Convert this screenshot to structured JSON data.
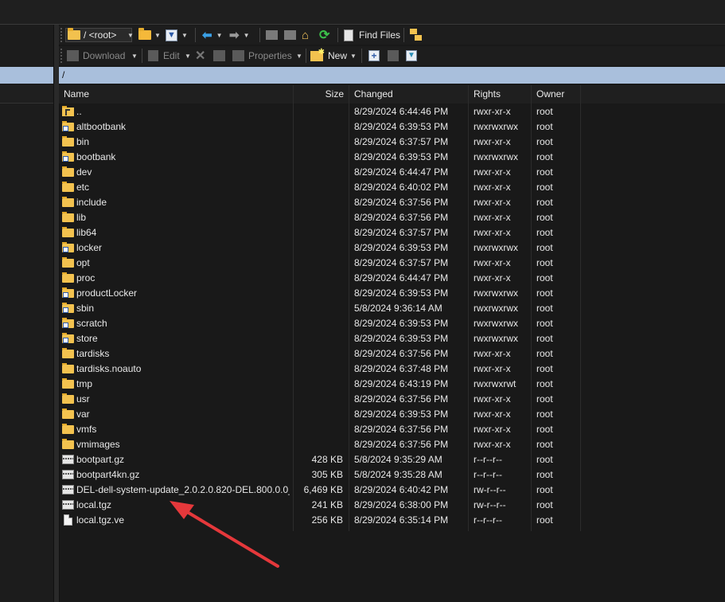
{
  "toolbar1": {
    "path_dropdown_label": "/ <root>",
    "find_files_label": "Find Files"
  },
  "toolbar2": {
    "download_label": "Download",
    "edit_label": "Edit",
    "properties_label": "Properties",
    "new_label": "New"
  },
  "path_bar": {
    "path": "/"
  },
  "columns": {
    "name": "Name",
    "size": "Size",
    "changed": "Changed",
    "rights": "Rights",
    "owner": "Owner"
  },
  "files": [
    {
      "name": "..",
      "icon": "parent-folder-icon",
      "size": "",
      "changed": "8/29/2024 6:44:46 PM",
      "rights": "rwxr-xr-x",
      "owner": "root"
    },
    {
      "name": "altbootbank",
      "icon": "folder-link-icon",
      "size": "",
      "changed": "8/29/2024 6:39:53 PM",
      "rights": "rwxrwxrwx",
      "owner": "root"
    },
    {
      "name": "bin",
      "icon": "folder-icon",
      "size": "",
      "changed": "8/29/2024 6:37:57 PM",
      "rights": "rwxr-xr-x",
      "owner": "root"
    },
    {
      "name": "bootbank",
      "icon": "folder-link-icon",
      "size": "",
      "changed": "8/29/2024 6:39:53 PM",
      "rights": "rwxrwxrwx",
      "owner": "root"
    },
    {
      "name": "dev",
      "icon": "folder-icon",
      "size": "",
      "changed": "8/29/2024 6:44:47 PM",
      "rights": "rwxr-xr-x",
      "owner": "root"
    },
    {
      "name": "etc",
      "icon": "folder-icon",
      "size": "",
      "changed": "8/29/2024 6:40:02 PM",
      "rights": "rwxr-xr-x",
      "owner": "root"
    },
    {
      "name": "include",
      "icon": "folder-icon",
      "size": "",
      "changed": "8/29/2024 6:37:56 PM",
      "rights": "rwxr-xr-x",
      "owner": "root"
    },
    {
      "name": "lib",
      "icon": "folder-icon",
      "size": "",
      "changed": "8/29/2024 6:37:56 PM",
      "rights": "rwxr-xr-x",
      "owner": "root"
    },
    {
      "name": "lib64",
      "icon": "folder-icon",
      "size": "",
      "changed": "8/29/2024 6:37:57 PM",
      "rights": "rwxr-xr-x",
      "owner": "root"
    },
    {
      "name": "locker",
      "icon": "folder-link-icon",
      "size": "",
      "changed": "8/29/2024 6:39:53 PM",
      "rights": "rwxrwxrwx",
      "owner": "root"
    },
    {
      "name": "opt",
      "icon": "folder-icon",
      "size": "",
      "changed": "8/29/2024 6:37:57 PM",
      "rights": "rwxr-xr-x",
      "owner": "root"
    },
    {
      "name": "proc",
      "icon": "folder-icon",
      "size": "",
      "changed": "8/29/2024 6:44:47 PM",
      "rights": "rwxr-xr-x",
      "owner": "root"
    },
    {
      "name": "productLocker",
      "icon": "folder-link-icon",
      "size": "",
      "changed": "8/29/2024 6:39:53 PM",
      "rights": "rwxrwxrwx",
      "owner": "root"
    },
    {
      "name": "sbin",
      "icon": "folder-link-icon",
      "size": "",
      "changed": "5/8/2024 9:36:14 AM",
      "rights": "rwxrwxrwx",
      "owner": "root"
    },
    {
      "name": "scratch",
      "icon": "folder-link-icon",
      "size": "",
      "changed": "8/29/2024 6:39:53 PM",
      "rights": "rwxrwxrwx",
      "owner": "root"
    },
    {
      "name": "store",
      "icon": "folder-link-icon",
      "size": "",
      "changed": "8/29/2024 6:39:53 PM",
      "rights": "rwxrwxrwx",
      "owner": "root"
    },
    {
      "name": "tardisks",
      "icon": "folder-icon",
      "size": "",
      "changed": "8/29/2024 6:37:56 PM",
      "rights": "rwxr-xr-x",
      "owner": "root"
    },
    {
      "name": "tardisks.noauto",
      "icon": "folder-icon",
      "size": "",
      "changed": "8/29/2024 6:37:48 PM",
      "rights": "rwxr-xr-x",
      "owner": "root"
    },
    {
      "name": "tmp",
      "icon": "folder-icon",
      "size": "",
      "changed": "8/29/2024 6:43:19 PM",
      "rights": "rwxrwxrwt",
      "owner": "root"
    },
    {
      "name": "usr",
      "icon": "folder-icon",
      "size": "",
      "changed": "8/29/2024 6:37:56 PM",
      "rights": "rwxr-xr-x",
      "owner": "root"
    },
    {
      "name": "var",
      "icon": "folder-icon",
      "size": "",
      "changed": "8/29/2024 6:39:53 PM",
      "rights": "rwxr-xr-x",
      "owner": "root"
    },
    {
      "name": "vmfs",
      "icon": "folder-icon",
      "size": "",
      "changed": "8/29/2024 6:37:56 PM",
      "rights": "rwxr-xr-x",
      "owner": "root"
    },
    {
      "name": "vmimages",
      "icon": "folder-icon",
      "size": "",
      "changed": "8/29/2024 6:37:56 PM",
      "rights": "rwxr-xr-x",
      "owner": "root"
    },
    {
      "name": "bootpart.gz",
      "icon": "archive-icon",
      "size": "428 KB",
      "changed": "5/8/2024 9:35:29 AM",
      "rights": "r--r--r--",
      "owner": "root"
    },
    {
      "name": "bootpart4kn.gz",
      "icon": "archive-icon",
      "size": "305 KB",
      "changed": "5/8/2024 9:35:28 AM",
      "rights": "r--r--r--",
      "owner": "root"
    },
    {
      "name": "DEL-dell-system-update_2.0.2.0.820-DEL.800.0.0_...",
      "icon": "archive-icon",
      "size": "6,469 KB",
      "changed": "8/29/2024 6:40:42 PM",
      "rights": "rw-r--r--",
      "owner": "root"
    },
    {
      "name": "local.tgz",
      "icon": "archive-icon",
      "size": "241 KB",
      "changed": "8/29/2024 6:38:00 PM",
      "rights": "rw-r--r--",
      "owner": "root"
    },
    {
      "name": "local.tgz.ve",
      "icon": "file-icon",
      "size": "256 KB",
      "changed": "8/29/2024 6:35:14 PM",
      "rights": "r--r--r--",
      "owner": "root"
    }
  ],
  "colors": {
    "accent_path_bar": "#a9bfdc",
    "folder": "#f3c24f",
    "annotation_arrow": "#e5383b",
    "background": "#191919"
  }
}
